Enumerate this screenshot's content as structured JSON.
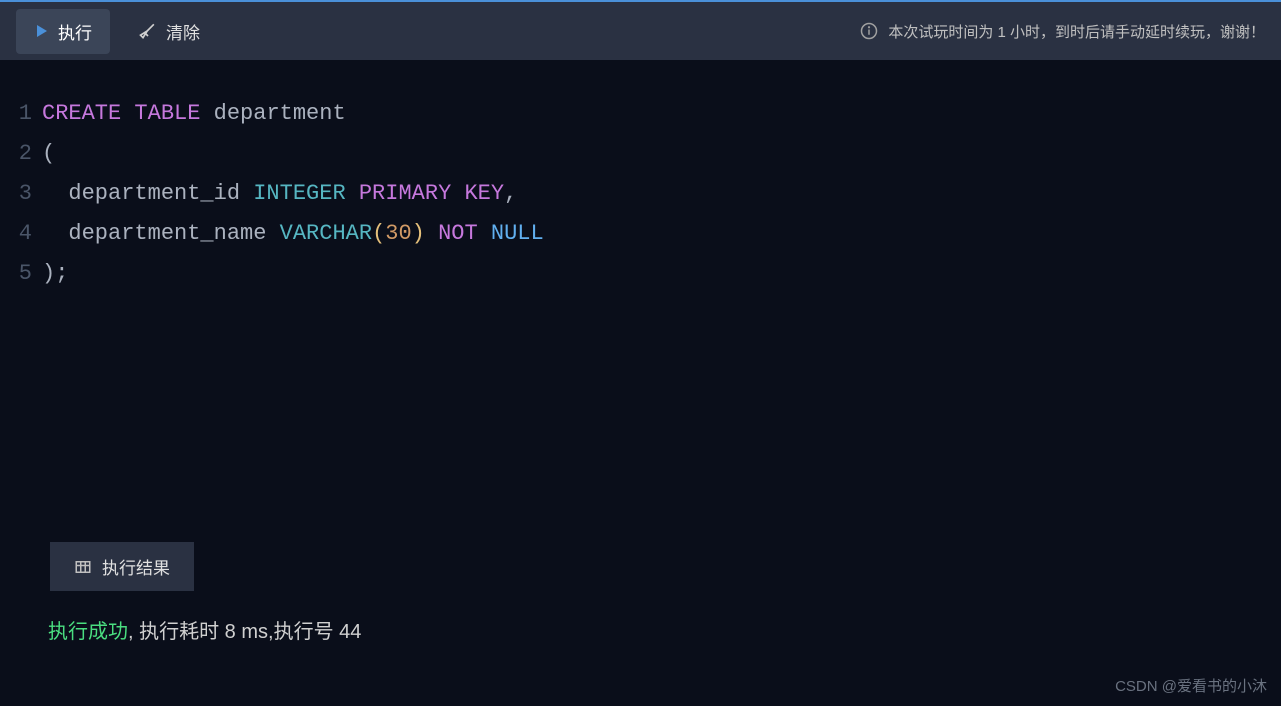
{
  "toolbar": {
    "execute_label": "执行",
    "clear_label": "清除"
  },
  "info_message": "本次试玩时间为 1 小时，到时后请手动延时续玩，谢谢！",
  "code_lines": [
    {
      "num": "1",
      "tokens": [
        {
          "cls": "kw-purple",
          "t": "CREATE"
        },
        {
          "cls": "txt-white",
          "t": " "
        },
        {
          "cls": "kw-purple",
          "t": "TABLE"
        },
        {
          "cls": "txt-white",
          "t": " department"
        }
      ]
    },
    {
      "num": "2",
      "tokens": [
        {
          "cls": "txt-white",
          "t": "("
        }
      ]
    },
    {
      "num": "3",
      "tokens": [
        {
          "cls": "txt-white",
          "t": "  department_id "
        },
        {
          "cls": "kw-teal",
          "t": "INTEGER"
        },
        {
          "cls": "txt-white",
          "t": " "
        },
        {
          "cls": "kw-purple",
          "t": "PRIMARY"
        },
        {
          "cls": "txt-white",
          "t": " "
        },
        {
          "cls": "kw-purple",
          "t": "KEY"
        },
        {
          "cls": "txt-white",
          "t": ","
        }
      ]
    },
    {
      "num": "4",
      "tokens": [
        {
          "cls": "txt-white",
          "t": "  department_name "
        },
        {
          "cls": "kw-teal",
          "t": "VARCHAR"
        },
        {
          "cls": "paren",
          "t": "("
        },
        {
          "cls": "kw-orange",
          "t": "30"
        },
        {
          "cls": "paren",
          "t": ")"
        },
        {
          "cls": "txt-white",
          "t": " "
        },
        {
          "cls": "kw-purple",
          "t": "NOT"
        },
        {
          "cls": "txt-white",
          "t": " "
        },
        {
          "cls": "kw-blue",
          "t": "NULL"
        }
      ]
    },
    {
      "num": "5",
      "tokens": [
        {
          "cls": "txt-white",
          "t": ");"
        }
      ]
    }
  ],
  "result_tab_label": "执行结果",
  "status": {
    "success": "执行成功",
    "detail": ", 执行耗时 8 ms,执行号 44"
  },
  "watermark": "CSDN @爱看书的小沐"
}
